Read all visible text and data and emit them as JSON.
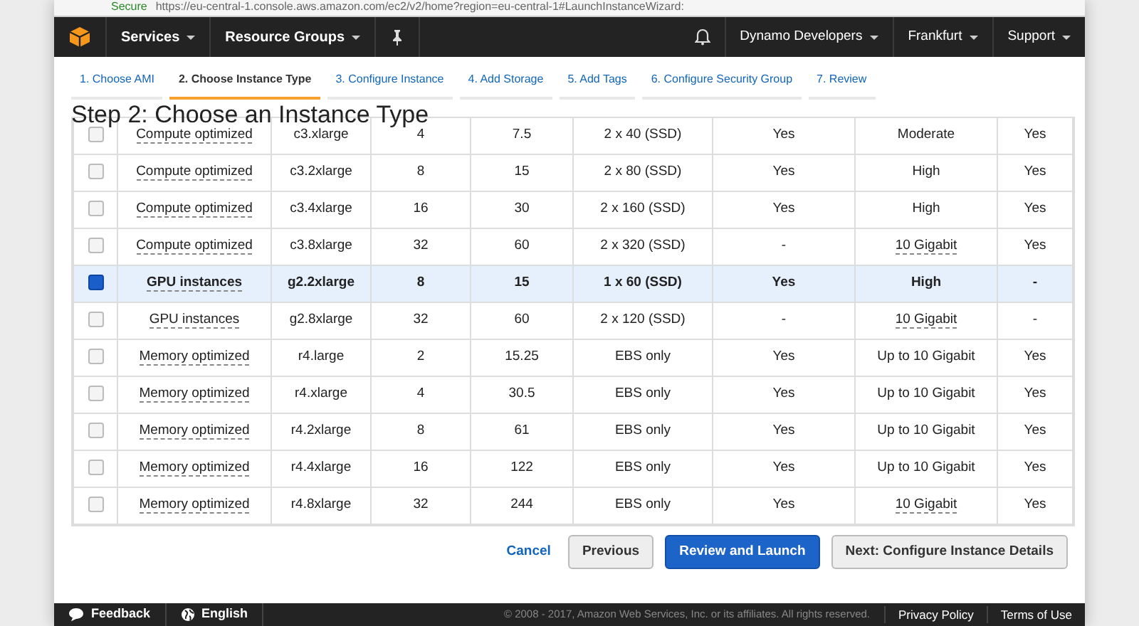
{
  "browser": {
    "secure_label": "Secure",
    "url": "https://eu-central-1.console.aws.amazon.com/ec2/v2/home?region=eu-central-1#LaunchInstanceWizard:"
  },
  "navbar": {
    "left": [
      {
        "label": "Services",
        "caret": true
      },
      {
        "label": "Resource Groups",
        "caret": true
      }
    ],
    "right": [
      {
        "label": "Dynamo Developers",
        "caret": true
      },
      {
        "label": "Frankfurt",
        "caret": true
      },
      {
        "label": "Support",
        "caret": true
      }
    ]
  },
  "wizard_tabs": [
    {
      "label": "1. Choose AMI",
      "selected": false
    },
    {
      "label": "2. Choose Instance Type",
      "selected": true
    },
    {
      "label": "3. Configure Instance",
      "selected": false
    },
    {
      "label": "4. Add Storage",
      "selected": false
    },
    {
      "label": "5. Add Tags",
      "selected": false
    },
    {
      "label": "6. Configure Security Group",
      "selected": false
    },
    {
      "label": "7. Review",
      "selected": false
    }
  ],
  "heading": "Step 2: Choose an Instance Type",
  "table": {
    "rows": [
      {
        "selected": false,
        "cells": [
          {
            "text": "Compute optimized",
            "dotted": true
          },
          {
            "text": "c3.xlarge"
          },
          {
            "text": "4"
          },
          {
            "text": "7.5"
          },
          {
            "text": "2 x 40 (SSD)"
          },
          {
            "text": "Yes"
          },
          {
            "text": "Moderate"
          },
          {
            "text": "Yes"
          }
        ]
      },
      {
        "selected": false,
        "cells": [
          {
            "text": "Compute optimized",
            "dotted": true
          },
          {
            "text": "c3.2xlarge"
          },
          {
            "text": "8"
          },
          {
            "text": "15"
          },
          {
            "text": "2 x 80 (SSD)"
          },
          {
            "text": "Yes"
          },
          {
            "text": "High"
          },
          {
            "text": "Yes"
          }
        ]
      },
      {
        "selected": false,
        "cells": [
          {
            "text": "Compute optimized",
            "dotted": true
          },
          {
            "text": "c3.4xlarge"
          },
          {
            "text": "16"
          },
          {
            "text": "30"
          },
          {
            "text": "2 x 160 (SSD)"
          },
          {
            "text": "Yes"
          },
          {
            "text": "High"
          },
          {
            "text": "Yes"
          }
        ]
      },
      {
        "selected": false,
        "cells": [
          {
            "text": "Compute optimized",
            "dotted": true
          },
          {
            "text": "c3.8xlarge"
          },
          {
            "text": "32"
          },
          {
            "text": "60"
          },
          {
            "text": "2 x 320 (SSD)"
          },
          {
            "text": "-"
          },
          {
            "text": "10 Gigabit",
            "dotted": true
          },
          {
            "text": "Yes"
          }
        ]
      },
      {
        "selected": true,
        "cells": [
          {
            "text": "GPU instances",
            "dotted": true
          },
          {
            "text": "g2.2xlarge"
          },
          {
            "text": "8"
          },
          {
            "text": "15"
          },
          {
            "text": "1 x 60 (SSD)"
          },
          {
            "text": "Yes"
          },
          {
            "text": "High"
          },
          {
            "text": "-"
          }
        ]
      },
      {
        "selected": false,
        "cells": [
          {
            "text": "GPU instances",
            "dotted": true
          },
          {
            "text": "g2.8xlarge"
          },
          {
            "text": "32"
          },
          {
            "text": "60"
          },
          {
            "text": "2 x 120 (SSD)"
          },
          {
            "text": "-"
          },
          {
            "text": "10 Gigabit",
            "dotted": true
          },
          {
            "text": "-"
          }
        ]
      },
      {
        "selected": false,
        "cells": [
          {
            "text": "Memory optimized",
            "dotted": true
          },
          {
            "text": "r4.large"
          },
          {
            "text": "2"
          },
          {
            "text": "15.25"
          },
          {
            "text": "EBS only"
          },
          {
            "text": "Yes"
          },
          {
            "text": "Up to 10 Gigabit"
          },
          {
            "text": "Yes"
          }
        ]
      },
      {
        "selected": false,
        "cells": [
          {
            "text": "Memory optimized",
            "dotted": true
          },
          {
            "text": "r4.xlarge"
          },
          {
            "text": "4"
          },
          {
            "text": "30.5"
          },
          {
            "text": "EBS only"
          },
          {
            "text": "Yes"
          },
          {
            "text": "Up to 10 Gigabit"
          },
          {
            "text": "Yes"
          }
        ]
      },
      {
        "selected": false,
        "cells": [
          {
            "text": "Memory optimized",
            "dotted": true
          },
          {
            "text": "r4.2xlarge"
          },
          {
            "text": "8"
          },
          {
            "text": "61"
          },
          {
            "text": "EBS only"
          },
          {
            "text": "Yes"
          },
          {
            "text": "Up to 10 Gigabit"
          },
          {
            "text": "Yes"
          }
        ]
      },
      {
        "selected": false,
        "cells": [
          {
            "text": "Memory optimized",
            "dotted": true
          },
          {
            "text": "r4.4xlarge"
          },
          {
            "text": "16"
          },
          {
            "text": "122"
          },
          {
            "text": "EBS only"
          },
          {
            "text": "Yes"
          },
          {
            "text": "Up to 10 Gigabit"
          },
          {
            "text": "Yes"
          }
        ]
      },
      {
        "selected": false,
        "cells": [
          {
            "text": "Memory optimized",
            "dotted": true
          },
          {
            "text": "r4.8xlarge"
          },
          {
            "text": "32"
          },
          {
            "text": "244"
          },
          {
            "text": "EBS only"
          },
          {
            "text": "Yes"
          },
          {
            "text": "10 Gigabit",
            "dotted": true
          },
          {
            "text": "Yes"
          }
        ]
      }
    ]
  },
  "actions": [
    {
      "label": "Cancel",
      "kind": "link"
    },
    {
      "label": "Previous",
      "kind": "secondary"
    },
    {
      "label": "Review and Launch",
      "kind": "primary"
    },
    {
      "label": "Next: Configure Instance Details",
      "kind": "secondary"
    }
  ],
  "footer": {
    "feedback": "Feedback",
    "language": "English",
    "copyright": "© 2008 - 2017, Amazon Web Services, Inc. or its affiliates. All rights reserved.",
    "links": [
      "Privacy Policy",
      "Terms of Use"
    ]
  }
}
